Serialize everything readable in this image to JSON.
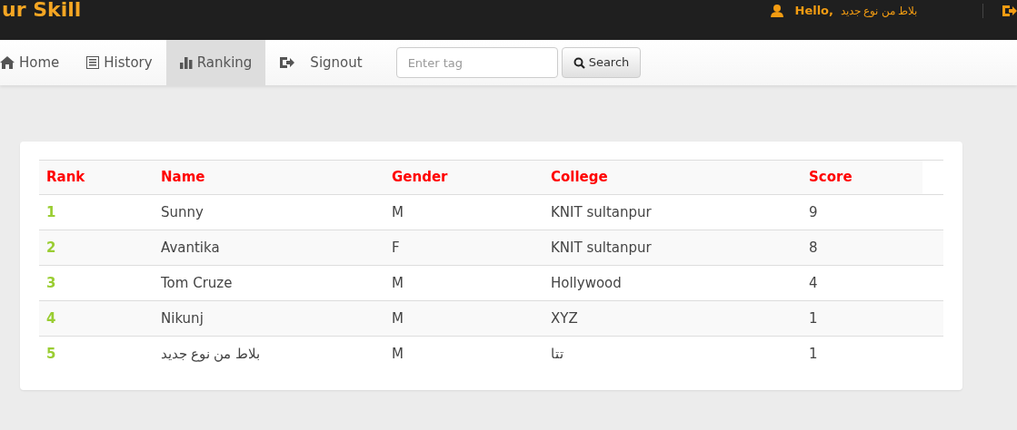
{
  "brand": "ur Skill",
  "user": {
    "greeting": "Hello,",
    "name": "بلاط من نوع جديد"
  },
  "nav": [
    {
      "label": "Home",
      "selected": false
    },
    {
      "label": "History",
      "selected": false
    },
    {
      "label": "Ranking",
      "selected": true
    },
    {
      "label": "Signout",
      "selected": false
    }
  ],
  "search": {
    "placeholder": "Enter tag",
    "button": "Search"
  },
  "table": {
    "columns": [
      "Rank",
      "Name",
      "Gender",
      "College",
      "Score"
    ],
    "rows": [
      [
        "1",
        "Sunny",
        "M",
        "KNIT sultanpur",
        "9"
      ],
      [
        "2",
        "Avantika",
        "F",
        "KNIT sultanpur",
        "8"
      ],
      [
        "3",
        "Tom Cruze",
        "M",
        "Hollywood",
        "4"
      ],
      [
        "4",
        "Nikunj",
        "M",
        "XYZ",
        "1"
      ],
      [
        "5",
        "بلاط من نوع جديد",
        "M",
        "تتا",
        "1"
      ]
    ]
  }
}
